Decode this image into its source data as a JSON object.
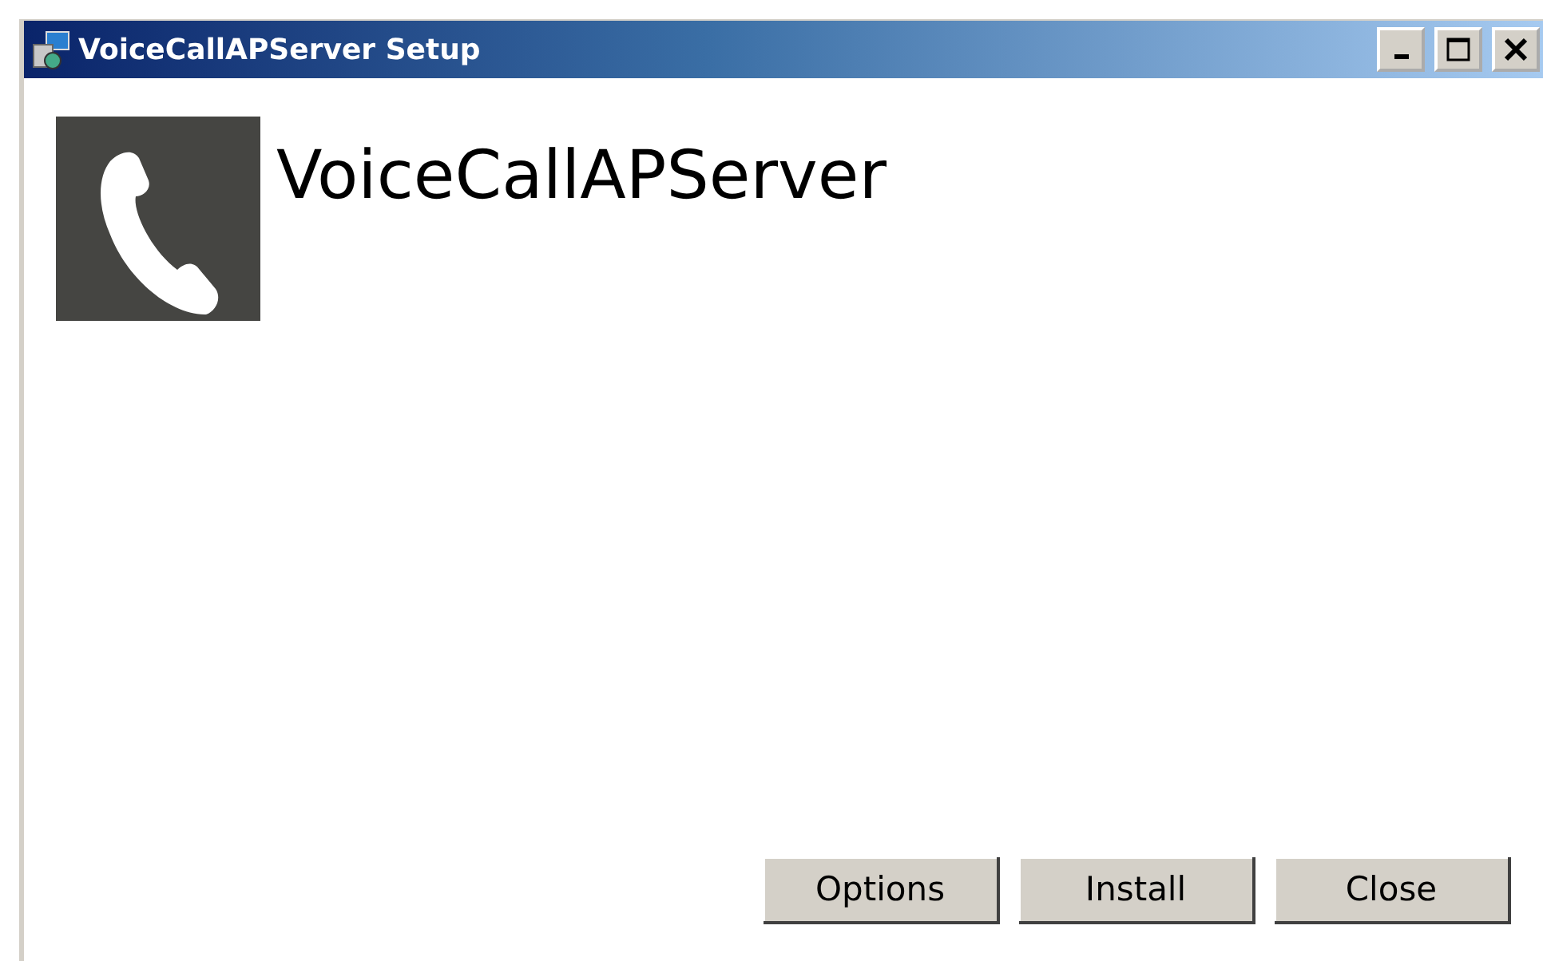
{
  "window": {
    "title": "VoiceCallAPServer Setup"
  },
  "product": {
    "name": "VoiceCallAPServer"
  },
  "buttons": [
    {
      "label": "Options"
    },
    {
      "label": "Install"
    },
    {
      "label": "Close"
    }
  ]
}
